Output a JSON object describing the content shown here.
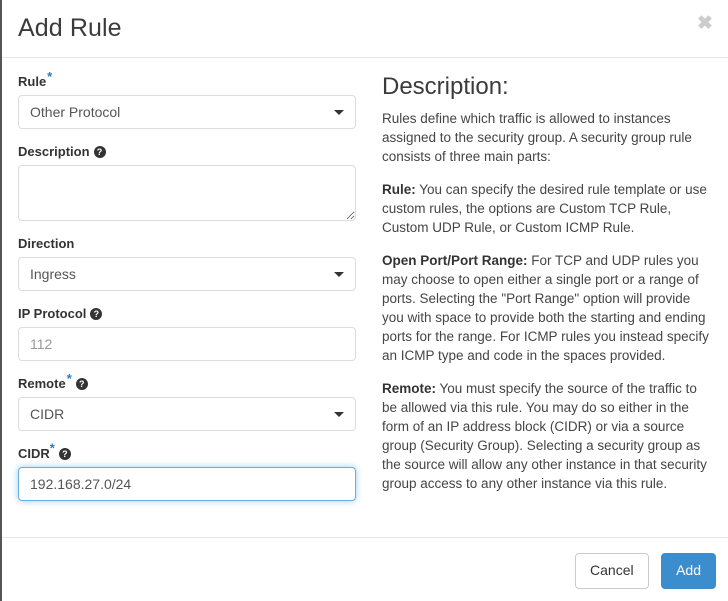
{
  "dialog": {
    "title": "Add Rule",
    "close_label": "✖"
  },
  "form": {
    "rule": {
      "label": "Rule",
      "required_mark": "*",
      "value": "Other Protocol",
      "options": [
        "Other Protocol"
      ]
    },
    "description": {
      "label": "Description",
      "help_glyph": "?",
      "value": "",
      "placeholder": ""
    },
    "direction": {
      "label": "Direction",
      "value": "Ingress",
      "options": [
        "Ingress"
      ]
    },
    "ip_protocol": {
      "label": "IP Protocol",
      "help_glyph": "?",
      "value": "",
      "placeholder": "112"
    },
    "remote": {
      "label": "Remote",
      "required_mark": "*",
      "help_glyph": "?",
      "value": "CIDR",
      "options": [
        "CIDR"
      ]
    },
    "cidr": {
      "label": "CIDR",
      "required_mark": "*",
      "help_glyph": "?",
      "value": "192.168.27.0/24",
      "placeholder": "",
      "focused": true
    }
  },
  "description_panel": {
    "heading": "Description:",
    "paragraphs": [
      {
        "lead": "",
        "text": "Rules define which traffic is allowed to instances assigned to the security group. A security group rule consists of three main parts:"
      },
      {
        "lead": "Rule:",
        "text": " You can specify the desired rule template or use custom rules, the options are Custom TCP Rule, Custom UDP Rule, or Custom ICMP Rule."
      },
      {
        "lead": "Open Port/Port Range:",
        "text": " For TCP and UDP rules you may choose to open either a single port or a range of ports. Selecting the \"Port Range\" option will provide you with space to provide both the starting and ending ports for the range. For ICMP rules you instead specify an ICMP type and code in the spaces provided."
      },
      {
        "lead": "Remote:",
        "text": " You must specify the source of the traffic to be allowed via this rule. You may do so either in the form of an IP address block (CIDR) or via a source group (Security Group). Selecting a security group as the source will allow any other instance in that security group access to any other instance via this rule."
      }
    ]
  },
  "footer": {
    "cancel_label": "Cancel",
    "add_label": "Add"
  },
  "colors": {
    "primary": "#3c8dcd",
    "required_star": "#337ab7",
    "focus_border": "#66afe9",
    "text": "#333333",
    "placeholder": "#999999"
  }
}
